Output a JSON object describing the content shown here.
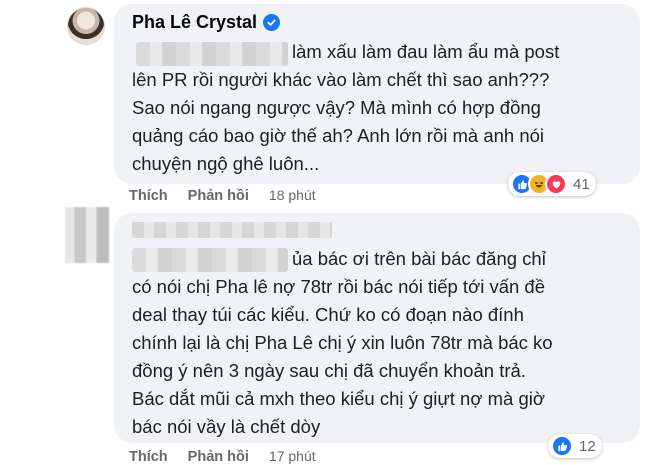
{
  "comment_1": {
    "author": "Pha Lê Crystal",
    "first_line": "làm xấu làm đau làm ẩu mà post",
    "text": "lên PR rồi người khác vào làm chết thì sao anh???\nSao nói ngang ngược vậy? Mà mình có hợp đồng\nquảng cáo bao giờ thế ah? Anh lớn rồi mà anh nói\nchuyện ngộ ghê luôn...",
    "like_label": "Thích",
    "reply_label": "Phản hồi",
    "time": "18 phút",
    "reaction_count": "41",
    "reaction_icons": [
      "like-icon",
      "haha-icon",
      "love-icon"
    ]
  },
  "comment_2": {
    "first_line": "ủa bác ơi trên bài bác đăng chỉ",
    "text": "có nói chị Pha lê nợ 78tr rồi bác nói tiếp tới vấn đề\ndeal thay túi các kiểu. Chứ ko có đoạn nào đính\nchính lại là chị Pha Lê chị ý xin luôn 78tr mà bác ko\nđồng ý nên 3 ngày sau chị đã chuyển khoản trả.\nBác dắt mũi cả mxh theo kiểu chị ý giựt nợ mà giờ\nbác nói vầy là chết dòy",
    "like_label": "Thích",
    "reply_label": "Phản hồi",
    "time": "17 phút",
    "reaction_count": "12",
    "reaction_icons": [
      "like-icon"
    ]
  },
  "colors": {
    "bubble_bg": "#f0f2f5",
    "secondary_text": "#65676b",
    "verified_blue": "#1877f2",
    "like_blue": "#1877f2",
    "haha_yellow": "#f7b125",
    "love_red": "#f33e58"
  }
}
